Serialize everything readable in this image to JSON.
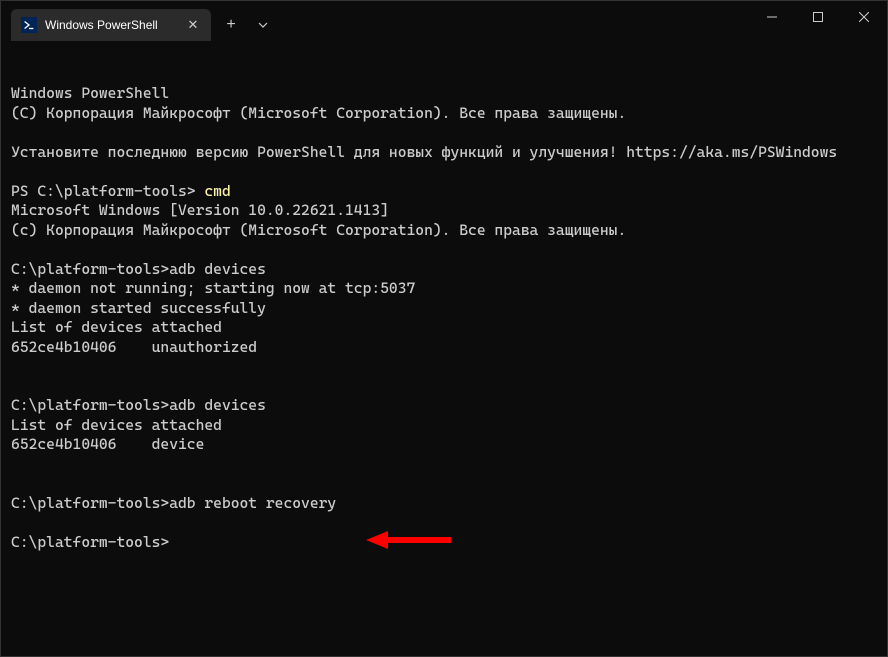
{
  "titlebar": {
    "tab_label": "Windows PowerShell",
    "close_glyph": "✕",
    "new_tab_glyph": "+",
    "dropdown_glyph": "⌄",
    "minimize_glyph": "─",
    "maximize_glyph": "□",
    "window_close_glyph": "✕"
  },
  "terminal": {
    "lines": [
      {
        "text": "Windows PowerShell"
      },
      {
        "text": "(C) Корпорация Майкрософт (Microsoft Corporation). Все права защищены."
      },
      {
        "text": ""
      },
      {
        "text": "Установите последнюю версию PowerShell для новых функций и улучшения! https://aka.ms/PSWindows"
      },
      {
        "text": ""
      },
      {
        "prompt": "PS C:\\platform-tools> ",
        "cmd": "cmd",
        "cmd_class": "cmd-yellow"
      },
      {
        "text": "Microsoft Windows [Version 10.0.22621.1413]"
      },
      {
        "text": "(c) Корпорация Майкрософт (Microsoft Corporation). Все права защищены."
      },
      {
        "text": ""
      },
      {
        "prompt": "C:\\platform-tools>",
        "cmd": "adb devices"
      },
      {
        "text": "* daemon not running; starting now at tcp:5037"
      },
      {
        "text": "* daemon started successfully"
      },
      {
        "text": "List of devices attached"
      },
      {
        "text": "652ce4b10406    unauthorized"
      },
      {
        "text": ""
      },
      {
        "text": ""
      },
      {
        "prompt": "C:\\platform-tools>",
        "cmd": "adb devices"
      },
      {
        "text": "List of devices attached"
      },
      {
        "text": "652ce4b10406    device"
      },
      {
        "text": ""
      },
      {
        "text": ""
      },
      {
        "prompt": "C:\\platform-tools>",
        "cmd": "adb reboot recovery"
      },
      {
        "text": ""
      },
      {
        "prompt": "C:\\platform-tools>",
        "cmd": ""
      }
    ]
  },
  "annotation": {
    "arrow_color": "#ff0000"
  }
}
